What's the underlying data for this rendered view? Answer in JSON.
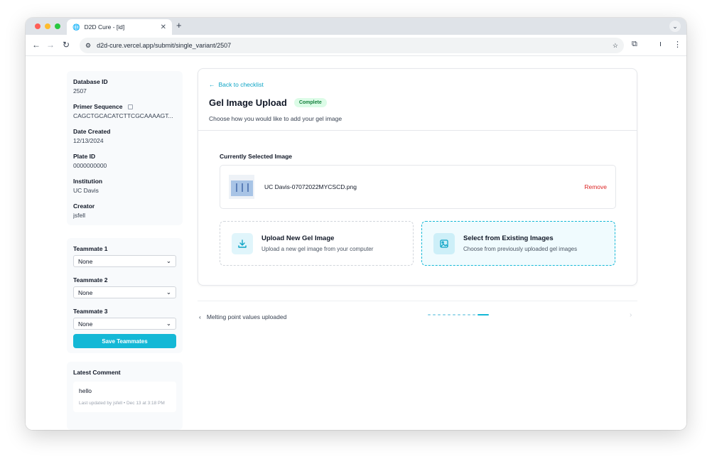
{
  "browser": {
    "tab_title": "D2D Cure - [id]",
    "url": "d2d-cure.vercel.app/submit/single_variant/2507"
  },
  "sidebar": {
    "meta": [
      {
        "label": "Database ID",
        "value": "2507"
      },
      {
        "label": "Primer Sequence",
        "value": "CAGCTGCACATCTTCGCAAAAGT..."
      },
      {
        "label": "Date Created",
        "value": "12/13/2024"
      },
      {
        "label": "Plate ID",
        "value": "0000000000"
      },
      {
        "label": "Institution",
        "value": "UC Davis"
      },
      {
        "label": "Creator",
        "value": "jsfell"
      }
    ],
    "teammates": [
      {
        "label": "Teammate 1",
        "value": "None"
      },
      {
        "label": "Teammate 2",
        "value": "None"
      },
      {
        "label": "Teammate 3",
        "value": "None"
      }
    ],
    "save_label": "Save Teammates",
    "comment": {
      "title": "Latest Comment",
      "text": "hello",
      "meta": "Last updated by jsfell • Dec 13 at 3:18 PM"
    }
  },
  "main": {
    "back_label": "Back to checklist",
    "title": "Gel Image Upload",
    "status": "Complete",
    "subtitle": "Choose how you would like to add your gel image",
    "current_label": "Currently Selected Image",
    "file_name": "UC Davis-07072022MYCSCD.png",
    "remove_label": "Remove",
    "options": [
      {
        "title": "Upload New Gel Image",
        "desc": "Upload a new gel image from your computer"
      },
      {
        "title": "Select from Existing Images",
        "desc": "Choose from previously uploaded gel images"
      }
    ]
  },
  "footer_nav": {
    "prev_label": "Melting point values uploaded",
    "steps_total": 11,
    "current_step": 11
  },
  "colors": {
    "accent": "#14b8d6",
    "complete_bg": "#dcfce7",
    "remove": "#dc2626"
  }
}
